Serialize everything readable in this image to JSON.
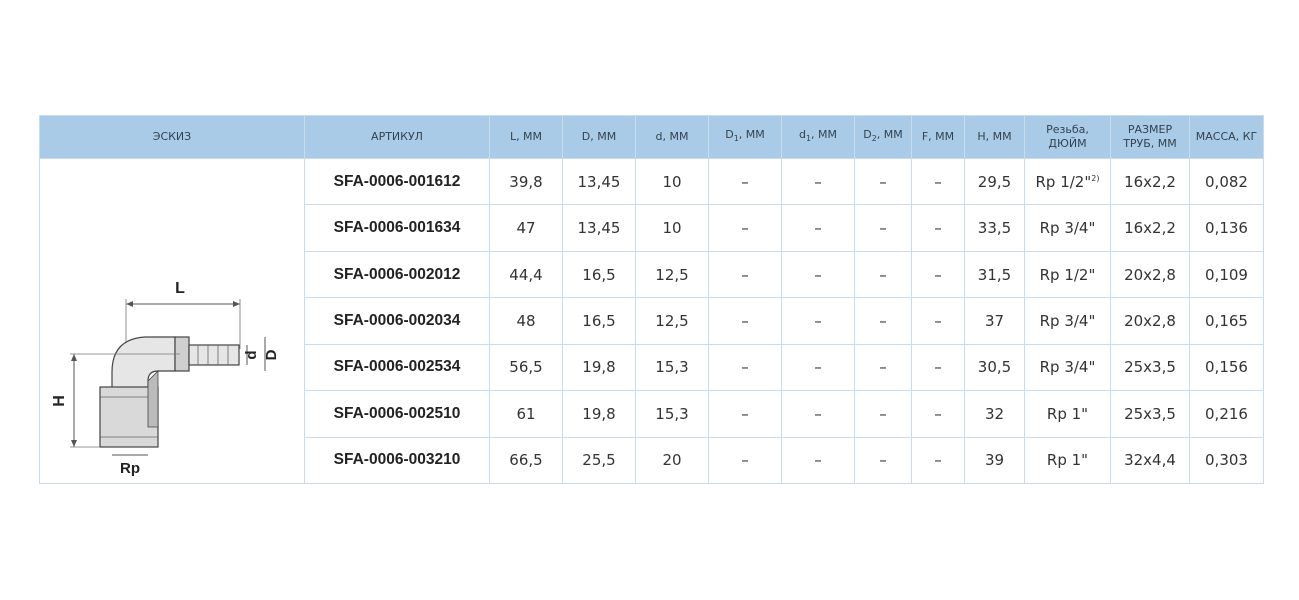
{
  "headers": {
    "sketch": "ЭСКИЗ",
    "article": "АРТИКУЛ",
    "L": "L, ММ",
    "D": "D, ММ",
    "d": "d, ММ",
    "D1_base": "D",
    "D1_sub": "1",
    "D1_unit": ", ММ",
    "d1_base": "d",
    "d1_sub": "1",
    "d1_unit": ", ММ",
    "D2_base": "D",
    "D2_sub": "2",
    "D2_unit": ", ММ",
    "F": "F, ММ",
    "H": "H, ММ",
    "thread_line1": "Резьба,",
    "thread_line2": "ДЮЙМ",
    "pipe_line1": "РАЗМЕР",
    "pipe_line2": "ТРУБ, ММ",
    "mass": "МАССА, КГ"
  },
  "sketch_labels": {
    "L": "L",
    "d": "d",
    "D": "D",
    "H": "H",
    "Rp": "Rp"
  },
  "rows": [
    {
      "article": "SFA-0006-001612",
      "L": "39,8",
      "D": "13,45",
      "d": "10",
      "D1": "–",
      "d1": "–",
      "D2": "–",
      "F": "–",
      "H": "29,5",
      "thread": "Rp 1/2\"",
      "thread_note": "2)",
      "pipe": "16x2,2",
      "mass": "0,082"
    },
    {
      "article": "SFA-0006-001634",
      "L": "47",
      "D": "13,45",
      "d": "10",
      "D1": "–",
      "d1": "–",
      "D2": "–",
      "F": "–",
      "H": "33,5",
      "thread": "Rp 3/4\"",
      "thread_note": "",
      "pipe": "16x2,2",
      "mass": "0,136"
    },
    {
      "article": "SFA-0006-002012",
      "L": "44,4",
      "D": "16,5",
      "d": "12,5",
      "D1": "–",
      "d1": "–",
      "D2": "–",
      "F": "–",
      "H": "31,5",
      "thread": "Rp 1/2\"",
      "thread_note": "",
      "pipe": "20x2,8",
      "mass": "0,109"
    },
    {
      "article": "SFA-0006-002034",
      "L": "48",
      "D": "16,5",
      "d": "12,5",
      "D1": "–",
      "d1": "–",
      "D2": "–",
      "F": "–",
      "H": "37",
      "thread": "Rp 3/4\"",
      "thread_note": "",
      "pipe": "20x2,8",
      "mass": "0,165"
    },
    {
      "article": "SFA-0006-002534",
      "L": "56,5",
      "D": "19,8",
      "d": "15,3",
      "D1": "–",
      "d1": "–",
      "D2": "–",
      "F": "–",
      "H": "30,5",
      "thread": "Rp 3/4\"",
      "thread_note": "",
      "pipe": "25x3,5",
      "mass": "0,156"
    },
    {
      "article": "SFA-0006-002510",
      "L": "61",
      "D": "19,8",
      "d": "15,3",
      "D1": "–",
      "d1": "–",
      "D2": "–",
      "F": "–",
      "H": "32",
      "thread": "Rp 1\"",
      "thread_note": "",
      "pipe": "25x3,5",
      "mass": "0,216"
    },
    {
      "article": "SFA-0006-003210",
      "L": "66,5",
      "D": "25,5",
      "d": "20",
      "D1": "–",
      "d1": "–",
      "D2": "–",
      "F": "–",
      "H": "39",
      "thread": "Rp 1\"",
      "thread_note": "",
      "pipe": "32x4,4",
      "mass": "0,303"
    }
  ]
}
